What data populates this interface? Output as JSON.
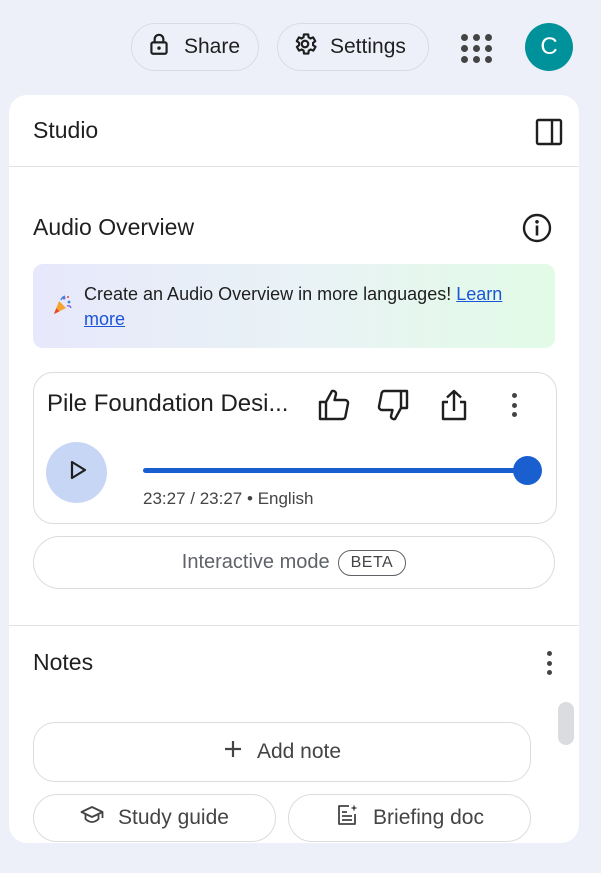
{
  "header": {
    "share_label": "Share",
    "settings_label": "Settings",
    "avatar_initial": "C"
  },
  "studio": {
    "title": "Studio",
    "audio_overview": {
      "title": "Audio Overview",
      "banner_text": "Create an Audio Overview in more languages!",
      "banner_link": "Learn more",
      "card": {
        "title": "Pile Foundation Desi...",
        "time": "23:27 / 23:27",
        "separator": "•",
        "language": "English",
        "progress": 1.0
      },
      "interactive_label": "Interactive mode",
      "beta_label": "BETA"
    },
    "notes": {
      "title": "Notes",
      "add_note_label": "Add note",
      "study_guide_label": "Study guide",
      "briefing_doc_label": "Briefing doc"
    }
  },
  "colors": {
    "accent": "#1a5fd0",
    "avatar": "#00929b",
    "play_bg": "#c6d6f4",
    "link": "#1a55d6"
  },
  "icons": [
    "lock-icon",
    "gear-icon",
    "apps-grid-icon",
    "collapse-panel-icon",
    "info-icon",
    "party-popper-icon",
    "thumbs-up-icon",
    "thumbs-down-icon",
    "share-icon",
    "more-vert-icon",
    "play-icon",
    "plus-icon",
    "graduation-cap-icon",
    "briefing-doc-icon"
  ]
}
